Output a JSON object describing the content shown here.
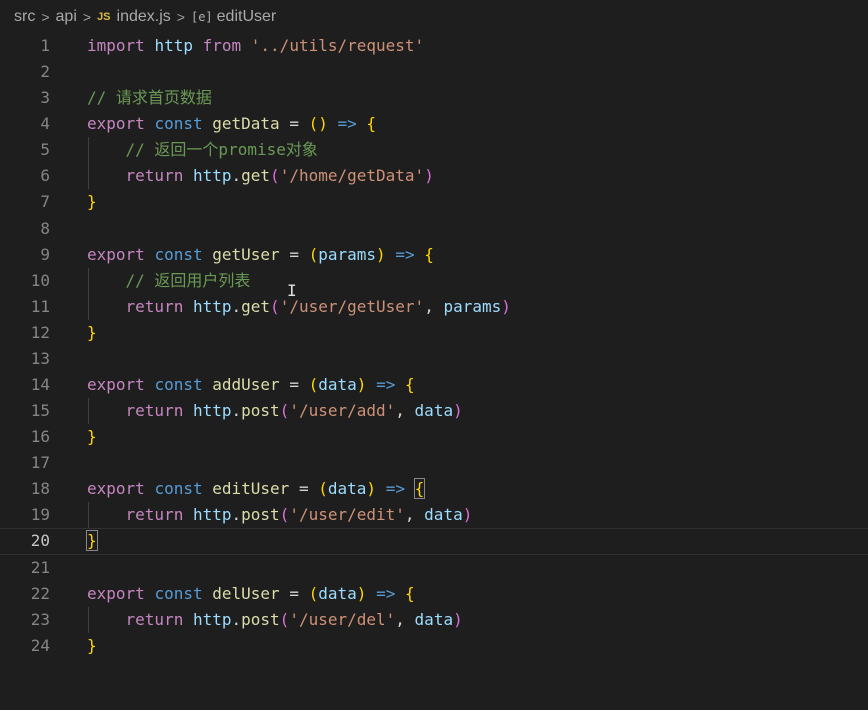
{
  "breadcrumb": {
    "items": [
      {
        "label": "src",
        "icon": null
      },
      {
        "label": "api",
        "icon": null
      },
      {
        "label": "index.js",
        "icon": "js-file-icon",
        "badge": "JS"
      },
      {
        "label": "editUser",
        "icon": "symbol-variable-icon",
        "badge": "[e]"
      }
    ],
    "separator": ">"
  },
  "editor": {
    "current_line": 20,
    "lines": [
      {
        "n": "1",
        "tokens": [
          [
            "kw",
            "import"
          ],
          [
            "sp",
            " "
          ],
          [
            "var",
            "http"
          ],
          [
            "sp",
            " "
          ],
          [
            "kw",
            "from"
          ],
          [
            "sp",
            " "
          ],
          [
            "str",
            "'../utils/request'"
          ]
        ]
      },
      {
        "n": "2",
        "tokens": []
      },
      {
        "n": "3",
        "tokens": [
          [
            "com",
            "// 请求首页数据"
          ]
        ]
      },
      {
        "n": "4",
        "tokens": [
          [
            "kw",
            "export"
          ],
          [
            "sp",
            " "
          ],
          [
            "kw2",
            "const"
          ],
          [
            "sp",
            " "
          ],
          [
            "fn",
            "getData"
          ],
          [
            "sp",
            " "
          ],
          [
            "op",
            "="
          ],
          [
            "sp",
            " "
          ],
          [
            "br",
            "()"
          ],
          [
            "sp",
            " "
          ],
          [
            "kw2",
            "=>"
          ],
          [
            "sp",
            " "
          ],
          [
            "br",
            "{"
          ]
        ]
      },
      {
        "n": "5",
        "indent": true,
        "tokens": [
          [
            "sp",
            "    "
          ],
          [
            "com",
            "// 返回一个promise对象"
          ]
        ]
      },
      {
        "n": "6",
        "indent": true,
        "tokens": [
          [
            "sp",
            "    "
          ],
          [
            "kw",
            "return"
          ],
          [
            "sp",
            " "
          ],
          [
            "var",
            "http"
          ],
          [
            "pun",
            "."
          ],
          [
            "fn",
            "get"
          ],
          [
            "br2",
            "("
          ],
          [
            "str",
            "'/home/getData'"
          ],
          [
            "br2",
            ")"
          ]
        ]
      },
      {
        "n": "7",
        "tokens": [
          [
            "br",
            "}"
          ]
        ]
      },
      {
        "n": "8",
        "tokens": []
      },
      {
        "n": "9",
        "tokens": [
          [
            "kw",
            "export"
          ],
          [
            "sp",
            " "
          ],
          [
            "kw2",
            "const"
          ],
          [
            "sp",
            " "
          ],
          [
            "fn",
            "getUser"
          ],
          [
            "sp",
            " "
          ],
          [
            "op",
            "="
          ],
          [
            "sp",
            " "
          ],
          [
            "br",
            "("
          ],
          [
            "var",
            "params"
          ],
          [
            "br",
            ")"
          ],
          [
            "sp",
            " "
          ],
          [
            "kw2",
            "=>"
          ],
          [
            "sp",
            " "
          ],
          [
            "br",
            "{"
          ]
        ]
      },
      {
        "n": "10",
        "indent": true,
        "tokens": [
          [
            "sp",
            "    "
          ],
          [
            "com",
            "// 返回用户列表"
          ]
        ]
      },
      {
        "n": "11",
        "indent": true,
        "tokens": [
          [
            "sp",
            "    "
          ],
          [
            "kw",
            "return"
          ],
          [
            "sp",
            " "
          ],
          [
            "var",
            "http"
          ],
          [
            "pun",
            "."
          ],
          [
            "fn",
            "get"
          ],
          [
            "br2",
            "("
          ],
          [
            "str",
            "'/user/getUser'"
          ],
          [
            "pun",
            ", "
          ],
          [
            "var",
            "params"
          ],
          [
            "br2",
            ")"
          ]
        ]
      },
      {
        "n": "12",
        "tokens": [
          [
            "br",
            "}"
          ]
        ]
      },
      {
        "n": "13",
        "tokens": []
      },
      {
        "n": "14",
        "tokens": [
          [
            "kw",
            "export"
          ],
          [
            "sp",
            " "
          ],
          [
            "kw2",
            "const"
          ],
          [
            "sp",
            " "
          ],
          [
            "fn",
            "addUser"
          ],
          [
            "sp",
            " "
          ],
          [
            "op",
            "="
          ],
          [
            "sp",
            " "
          ],
          [
            "br",
            "("
          ],
          [
            "var",
            "data"
          ],
          [
            "br",
            ")"
          ],
          [
            "sp",
            " "
          ],
          [
            "kw2",
            "=>"
          ],
          [
            "sp",
            " "
          ],
          [
            "br",
            "{"
          ]
        ]
      },
      {
        "n": "15",
        "indent": true,
        "tokens": [
          [
            "sp",
            "    "
          ],
          [
            "kw",
            "return"
          ],
          [
            "sp",
            " "
          ],
          [
            "var",
            "http"
          ],
          [
            "pun",
            "."
          ],
          [
            "fn",
            "post"
          ],
          [
            "br2",
            "("
          ],
          [
            "str",
            "'/user/add'"
          ],
          [
            "pun",
            ", "
          ],
          [
            "var",
            "data"
          ],
          [
            "br2",
            ")"
          ]
        ]
      },
      {
        "n": "16",
        "tokens": [
          [
            "br",
            "}"
          ]
        ]
      },
      {
        "n": "17",
        "tokens": []
      },
      {
        "n": "18",
        "tokens": [
          [
            "kw",
            "export"
          ],
          [
            "sp",
            " "
          ],
          [
            "kw2",
            "const"
          ],
          [
            "sp",
            " "
          ],
          [
            "fn",
            "editUser"
          ],
          [
            "sp",
            " "
          ],
          [
            "op",
            "="
          ],
          [
            "sp",
            " "
          ],
          [
            "br",
            "("
          ],
          [
            "var",
            "data"
          ],
          [
            "br",
            ")"
          ],
          [
            "sp",
            " "
          ],
          [
            "kw2",
            "=>"
          ],
          [
            "sp",
            " "
          ],
          [
            "brm",
            "{"
          ]
        ]
      },
      {
        "n": "19",
        "indent": true,
        "tokens": [
          [
            "sp",
            "    "
          ],
          [
            "kw",
            "return"
          ],
          [
            "sp",
            " "
          ],
          [
            "var",
            "http"
          ],
          [
            "pun",
            "."
          ],
          [
            "fn",
            "post"
          ],
          [
            "br2",
            "("
          ],
          [
            "str",
            "'/user/edit'"
          ],
          [
            "pun",
            ", "
          ],
          [
            "var",
            "data"
          ],
          [
            "br2",
            ")"
          ]
        ]
      },
      {
        "n": "20",
        "tokens": [
          [
            "brm",
            "}"
          ]
        ]
      },
      {
        "n": "21",
        "tokens": []
      },
      {
        "n": "22",
        "tokens": [
          [
            "kw",
            "export"
          ],
          [
            "sp",
            " "
          ],
          [
            "kw2",
            "const"
          ],
          [
            "sp",
            " "
          ],
          [
            "fn",
            "delUser"
          ],
          [
            "sp",
            " "
          ],
          [
            "op",
            "="
          ],
          [
            "sp",
            " "
          ],
          [
            "br",
            "("
          ],
          [
            "var",
            "data"
          ],
          [
            "br",
            ")"
          ],
          [
            "sp",
            " "
          ],
          [
            "kw2",
            "=>"
          ],
          [
            "sp",
            " "
          ],
          [
            "br",
            "{"
          ]
        ]
      },
      {
        "n": "23",
        "indent": true,
        "tokens": [
          [
            "sp",
            "    "
          ],
          [
            "kw",
            "return"
          ],
          [
            "sp",
            " "
          ],
          [
            "var",
            "http"
          ],
          [
            "pun",
            "."
          ],
          [
            "fn",
            "post"
          ],
          [
            "br2",
            "("
          ],
          [
            "str",
            "'/user/del'"
          ],
          [
            "pun",
            ", "
          ],
          [
            "var",
            "data"
          ],
          [
            "br2",
            ")"
          ]
        ]
      },
      {
        "n": "24",
        "tokens": [
          [
            "br",
            "}"
          ]
        ]
      }
    ]
  },
  "mouse_cursor": {
    "icon": "text-cursor-icon",
    "glyph": "I"
  },
  "colors": {
    "background": "#1e1e1e",
    "keyword": "#c586c0",
    "storage": "#569cd6",
    "function": "#dcdcaa",
    "variable": "#9cdcfe",
    "string": "#ce9178",
    "comment": "#6a9955",
    "bracket": "#ffd700"
  }
}
